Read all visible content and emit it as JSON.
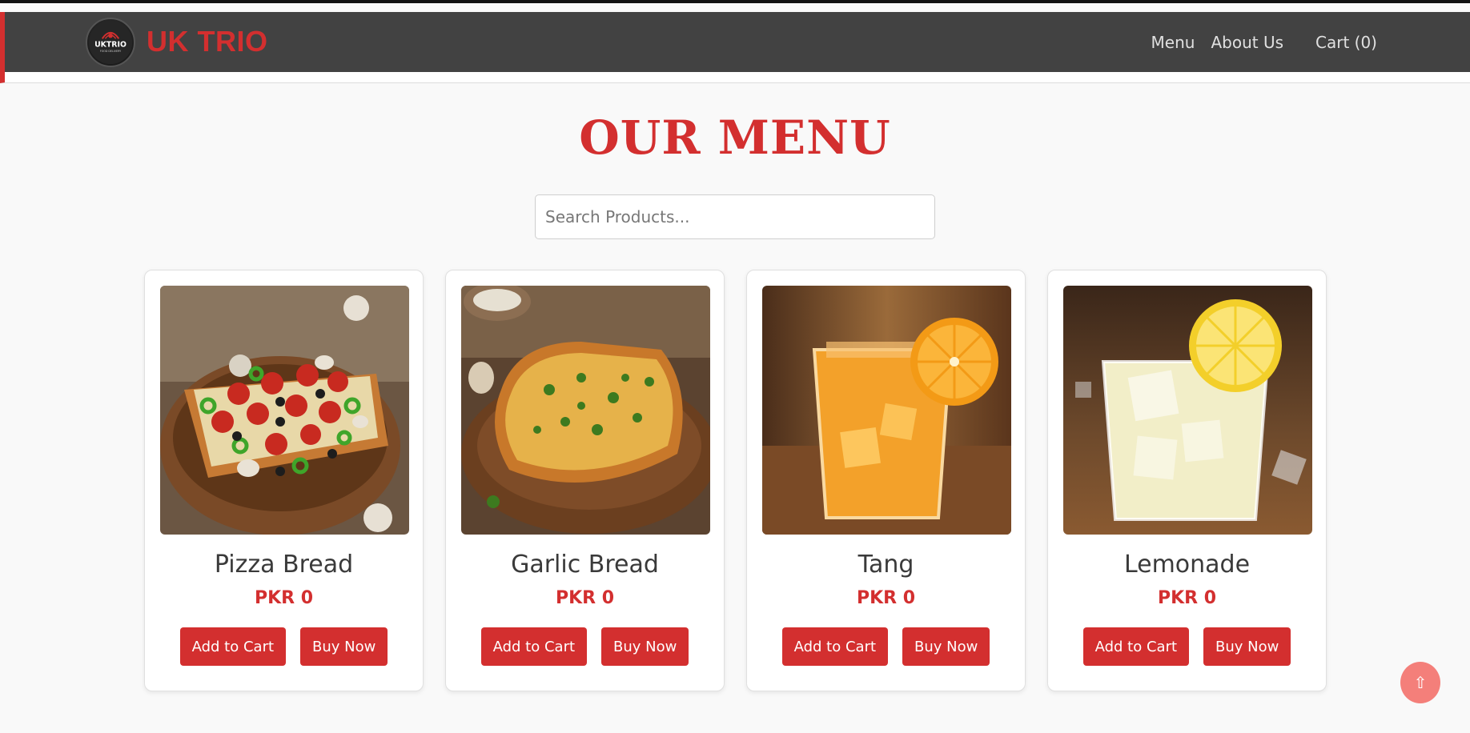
{
  "brand": {
    "name": "UK TRIO",
    "logo_text": "UKTRIO",
    "logo_tagline": "FOOD DELIVERY"
  },
  "nav": {
    "menu": "Menu",
    "about": "About Us",
    "cart": "Cart (0)"
  },
  "page": {
    "title": "OUR MENU"
  },
  "search": {
    "placeholder": "Search Products..."
  },
  "products": [
    {
      "name": "Pizza Bread",
      "price": "PKR 0",
      "add_label": "Add to Cart",
      "buy_label": "Buy Now"
    },
    {
      "name": "Garlic Bread",
      "price": "PKR 0",
      "add_label": "Add to Cart",
      "buy_label": "Buy Now"
    },
    {
      "name": "Tang",
      "price": "PKR 0",
      "add_label": "Add to Cart",
      "buy_label": "Buy Now"
    },
    {
      "name": "Lemonade",
      "price": "PKR 0",
      "add_label": "Add to Cart",
      "buy_label": "Buy Now"
    }
  ],
  "scroll_top": {
    "icon": "⇧"
  },
  "colors": {
    "accent": "#d32f2f",
    "navbar": "#424242",
    "background": "#f9f9f9",
    "scroll_button": "#f47f7a"
  }
}
